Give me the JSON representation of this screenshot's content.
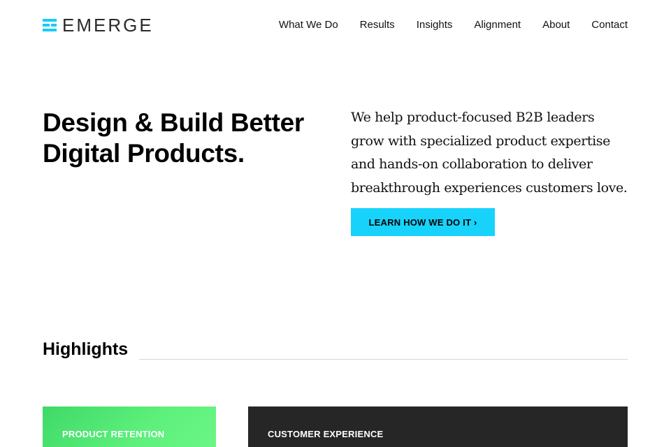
{
  "header": {
    "logo_text": "EMERGE",
    "nav": [
      {
        "label": "What We Do"
      },
      {
        "label": "Results"
      },
      {
        "label": "Insights"
      },
      {
        "label": "Alignment"
      },
      {
        "label": "About"
      },
      {
        "label": "Contact"
      }
    ]
  },
  "hero": {
    "title_line1": "Design & Build Better",
    "title_line2": "Digital Products.",
    "copy": "We help product-focused B2B leaders grow with specialized product expertise and hands-on collaboration to deliver breakthrough experiences customers love.",
    "cta_label": "LEARN HOW WE DO IT ›"
  },
  "highlights": {
    "title": "Highlights",
    "cards": [
      {
        "label": "PRODUCT RETENTION"
      },
      {
        "label": "CUSTOMER EXPERIENCE"
      }
    ]
  },
  "colors": {
    "accent": "#17d3fb",
    "green": "#4fe872",
    "dark": "#262626"
  }
}
